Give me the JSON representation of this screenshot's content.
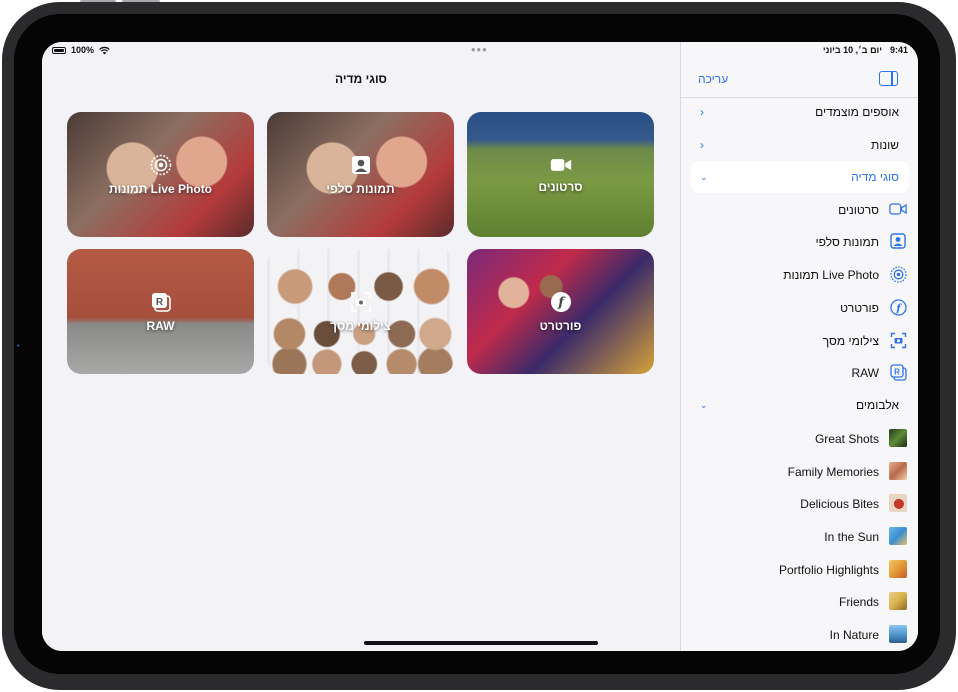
{
  "status_left": {
    "battery": "100%",
    "wifi_icon": "wifi-icon"
  },
  "status_right": {
    "time": "9:41",
    "date": "יום ב׳, 10 ביוני"
  },
  "main": {
    "title": "סוגי מדיה",
    "tiles": [
      {
        "label": "סרטונים",
        "icon": "video-icon"
      },
      {
        "label": "תמונות סלפי",
        "icon": "selfie-icon"
      },
      {
        "label": "תמונות Live Photo",
        "icon": "live-photo-icon"
      },
      {
        "label": "פורטרט",
        "icon": "portrait-icon"
      },
      {
        "label": "צילומי מסך",
        "icon": "screenshot-icon"
      },
      {
        "label": "RAW",
        "icon": "raw-icon"
      }
    ]
  },
  "sidebar": {
    "edit_label": "עריכה",
    "sections": [
      {
        "label": "אוספים מוצמדים"
      },
      {
        "label": "שונות"
      },
      {
        "label": "סוגי מדיה"
      }
    ],
    "media_types": [
      {
        "label": "סרטונים",
        "icon": "video-icon"
      },
      {
        "label": "תמונות סלפי",
        "icon": "selfie-icon"
      },
      {
        "label": "תמונות Live Photo",
        "icon": "live-photo-icon"
      },
      {
        "label": "פורטרט",
        "icon": "portrait-icon"
      },
      {
        "label": "צילומי מסך",
        "icon": "screenshot-icon"
      },
      {
        "label": "RAW",
        "icon": "raw-icon"
      }
    ],
    "albums_header": "אלבומים",
    "albums": [
      {
        "label": "Great Shots",
        "color": "#3f6b2a"
      },
      {
        "label": "Family Memories",
        "color": "#c9784f"
      },
      {
        "label": "Delicious Bites",
        "color": "#c0392b"
      },
      {
        "label": "In the Sun",
        "color": "#3a8fd1"
      },
      {
        "label": "Portfolio Highlights",
        "color": "#e39a35"
      },
      {
        "label": "Friends",
        "color": "#d8b24a"
      },
      {
        "label": "In Nature",
        "color": "#4a90c8"
      }
    ]
  },
  "colors": {
    "accent": "#2f73e8"
  }
}
